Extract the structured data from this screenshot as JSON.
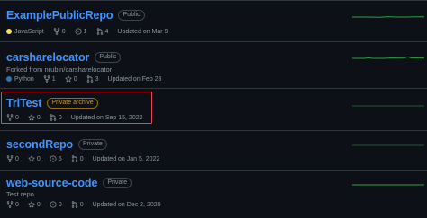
{
  "colors": {
    "background": "#0d1117",
    "link": "#4493f8",
    "muted": "#8b949e",
    "border": "#30363d",
    "archive_badge": "#d29922",
    "highlight": "#e5484d",
    "activity_graph": "#2ea043"
  },
  "repos": [
    {
      "name": "ExamplePublicRepo",
      "visibility": "Public",
      "description": "",
      "language": "JavaScript",
      "language_color": "#f1e05a",
      "stars": "0",
      "issues": "1",
      "pull_requests": "4",
      "updated": "Updated on Mar 9"
    },
    {
      "name": "carsharelocator",
      "visibility": "Public",
      "description": "Forked from nrubin/carsharelocator",
      "language": "Python",
      "language_color": "#3572A5",
      "forks": "1",
      "stars": "0",
      "pull_requests": "3",
      "updated": "Updated on Feb 28"
    },
    {
      "name": "TriTest",
      "visibility": "Private archive",
      "description": "",
      "forks": "0",
      "stars": "0",
      "pull_requests": "0",
      "updated": "Updated on Sep 15, 2022"
    },
    {
      "name": "secondRepo",
      "visibility": "Private",
      "description": "",
      "forks": "0",
      "stars": "0",
      "issues": "5",
      "pull_requests": "0",
      "updated": "Updated on Jan 5, 2022"
    },
    {
      "name": "web-source-code",
      "visibility": "Private",
      "description": "Test repo",
      "forks": "0",
      "stars": "0",
      "issues": "0",
      "pull_requests": "0",
      "updated": "Updated on Dec 2, 2020"
    }
  ],
  "icons": {
    "fork": "repo-forked-icon",
    "star": "star-icon",
    "issue": "issue-opened-icon",
    "pull_request": "git-pull-request-icon",
    "activity": "activity-sparkline"
  }
}
